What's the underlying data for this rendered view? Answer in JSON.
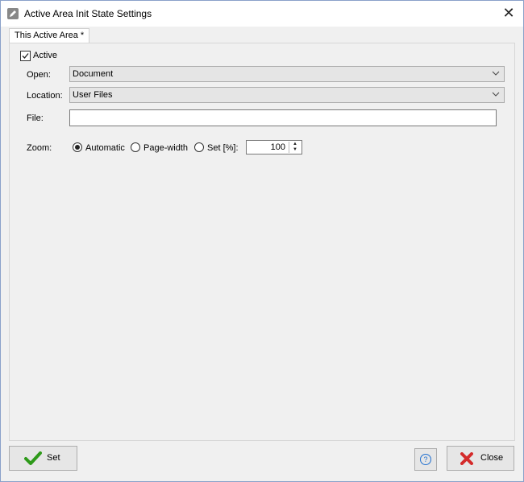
{
  "window": {
    "title": "Active Area Init State Settings",
    "title_icon": "pencil-icon",
    "close_glyph": "✕"
  },
  "tabs": [
    {
      "label": "This Active Area *"
    }
  ],
  "form": {
    "active": {
      "label": "Active",
      "checked": true
    },
    "open": {
      "label": "Open:",
      "value": "Document"
    },
    "location": {
      "label": "Location:",
      "value": "User Files"
    },
    "file": {
      "label": "File:",
      "value": ""
    },
    "zoom": {
      "label": "Zoom:",
      "options": [
        "Automatic",
        "Page-width",
        "Set [%]:"
      ],
      "selected": "Automatic",
      "value": "100"
    }
  },
  "footer": {
    "set_label": "Set",
    "help_glyph": "?",
    "close_label": "Close"
  },
  "colors": {
    "accent_check": "#2e9a1a",
    "close_red": "#d42b2b"
  }
}
